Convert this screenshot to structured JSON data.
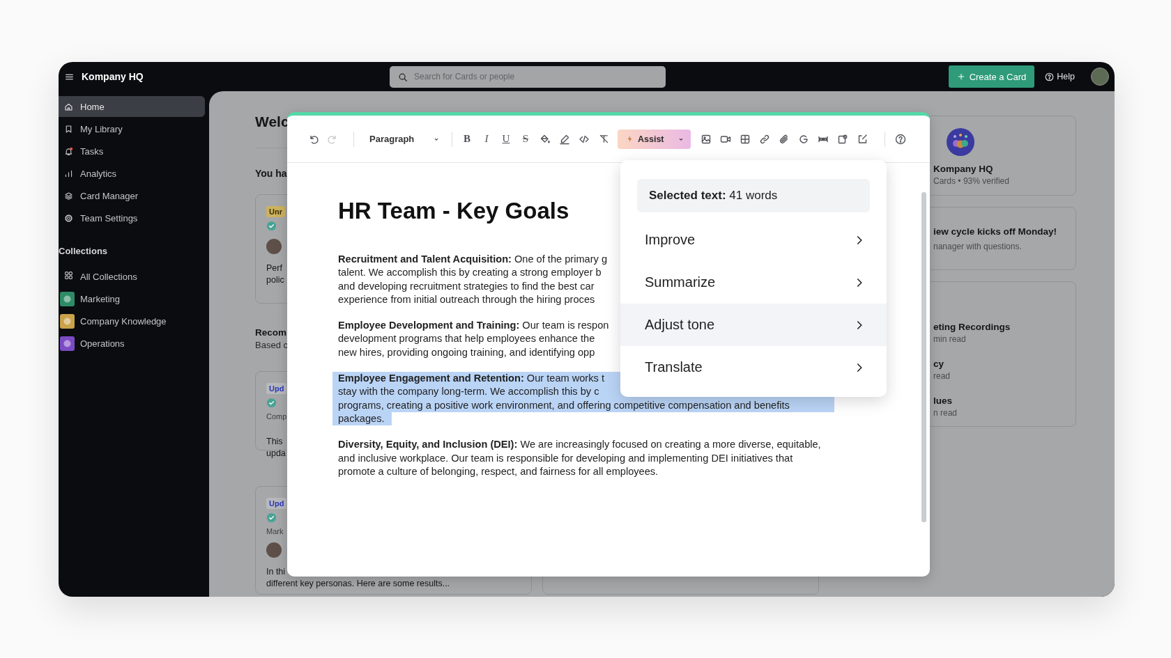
{
  "top_bar": {
    "app_name": "Kompany HQ",
    "search": {
      "placeholder": "Search for Cards or people"
    },
    "create_button": "Create a Card",
    "help_link": "Help"
  },
  "sidebar": {
    "items": [
      {
        "label": "Home",
        "kind": "home",
        "selected": true,
        "alert": false
      },
      {
        "label": "My Library",
        "kind": "bookmark",
        "selected": false,
        "alert": false
      },
      {
        "label": "Tasks",
        "kind": "bell",
        "selected": false,
        "alert": true
      },
      {
        "label": "Analytics",
        "kind": "chart",
        "selected": false,
        "alert": false
      },
      {
        "label": "Card Manager",
        "kind": "stack",
        "selected": false,
        "alert": false
      },
      {
        "label": "Team Settings",
        "kind": "gear",
        "selected": false,
        "alert": false
      }
    ],
    "collections_heading": "Collections",
    "collections": [
      {
        "label": "All Collections",
        "kind": "grid"
      },
      {
        "label": "Marketing",
        "kind": "tile",
        "color": "#2e8b67"
      },
      {
        "label": "Company Knowledge",
        "kind": "tile",
        "color": "#c9a24a"
      },
      {
        "label": "Operations",
        "kind": "tile",
        "color": "#7b4bc4"
      }
    ]
  },
  "home_feed": {
    "heading": "Welc",
    "intro": "You ha",
    "pinned_card": {
      "kind": "unread",
      "badge": "Unr",
      "lines": [
        "Perf",
        "polic"
      ]
    },
    "recommended": {
      "title": "Recom",
      "subtitle": "Based c",
      "cards": [
        {
          "kind": "updated",
          "badge": "Upd",
          "meta": "Comp",
          "lines": [
            "This",
            "upda"
          ]
        },
        {
          "kind": "updated",
          "badge": "Upd",
          "meta": "Mark",
          "lines": [
            "In thi",
            "different key personas. Here are some results..."
          ]
        }
      ]
    }
  },
  "right_panel": {
    "collection_card": {
      "title": "Kompany HQ",
      "stats": "Cards • 93% verified"
    },
    "announcement": {
      "title": "iew cycle kicks off Monday!",
      "text": "nanager with questions."
    },
    "reading_list": [
      {
        "title": "eting Recordings",
        "meta": "min read"
      },
      {
        "title": "cy",
        "meta": "read"
      },
      {
        "title": "lues",
        "meta": "n read"
      }
    ]
  },
  "editor": {
    "toolbar": {
      "undo": {
        "disabled": false
      },
      "redo": {
        "disabled": true
      },
      "block_style": "Paragraph",
      "format_marks": [
        "B",
        "I",
        "U",
        "S"
      ],
      "assist_button": "Assist"
    },
    "heading": "HR Team - Key Goals",
    "paragraphs": [
      {
        "selected": false,
        "lines": [
          "**Recruitment and Talent Acquisition:** One of the primary g",
          "talent. We accomplish this by creating a strong employer b",
          "and developing recruitment strategies to find the best car",
          "experience from initial outreach through the hiring proces"
        ]
      },
      {
        "selected": false,
        "lines": [
          "**Employee Development and Training:** Our team is respon",
          "development programs that help employees enhance the",
          "new hires, providing ongoing training, and identifying opp"
        ]
      },
      {
        "selected": true,
        "lines": [
          "**Employee Engagement and Retention:** Our team works t",
          "stay with the company long-term. We accomplish this by c",
          "programs, creating a positive work environment, and offering competitive compensation and benefits",
          "packages."
        ]
      },
      {
        "selected": false,
        "lines": [
          "**Diversity, Equity, and Inclusion (DEI):** We are increasingly focused on creating a more diverse, equitable,",
          "and inclusive workplace. Our team is responsible for developing and implementing DEI initiatives that",
          "promote a culture of belonging, respect, and fairness for all employees."
        ]
      }
    ]
  },
  "assist_menu": {
    "header": "**Selected text:** 41 words",
    "items": [
      {
        "label": "Improve",
        "selected": false
      },
      {
        "label": "Summarize",
        "selected": false
      },
      {
        "label": "Adjust tone",
        "selected": true
      },
      {
        "label": "Translate",
        "selected": false
      }
    ]
  }
}
